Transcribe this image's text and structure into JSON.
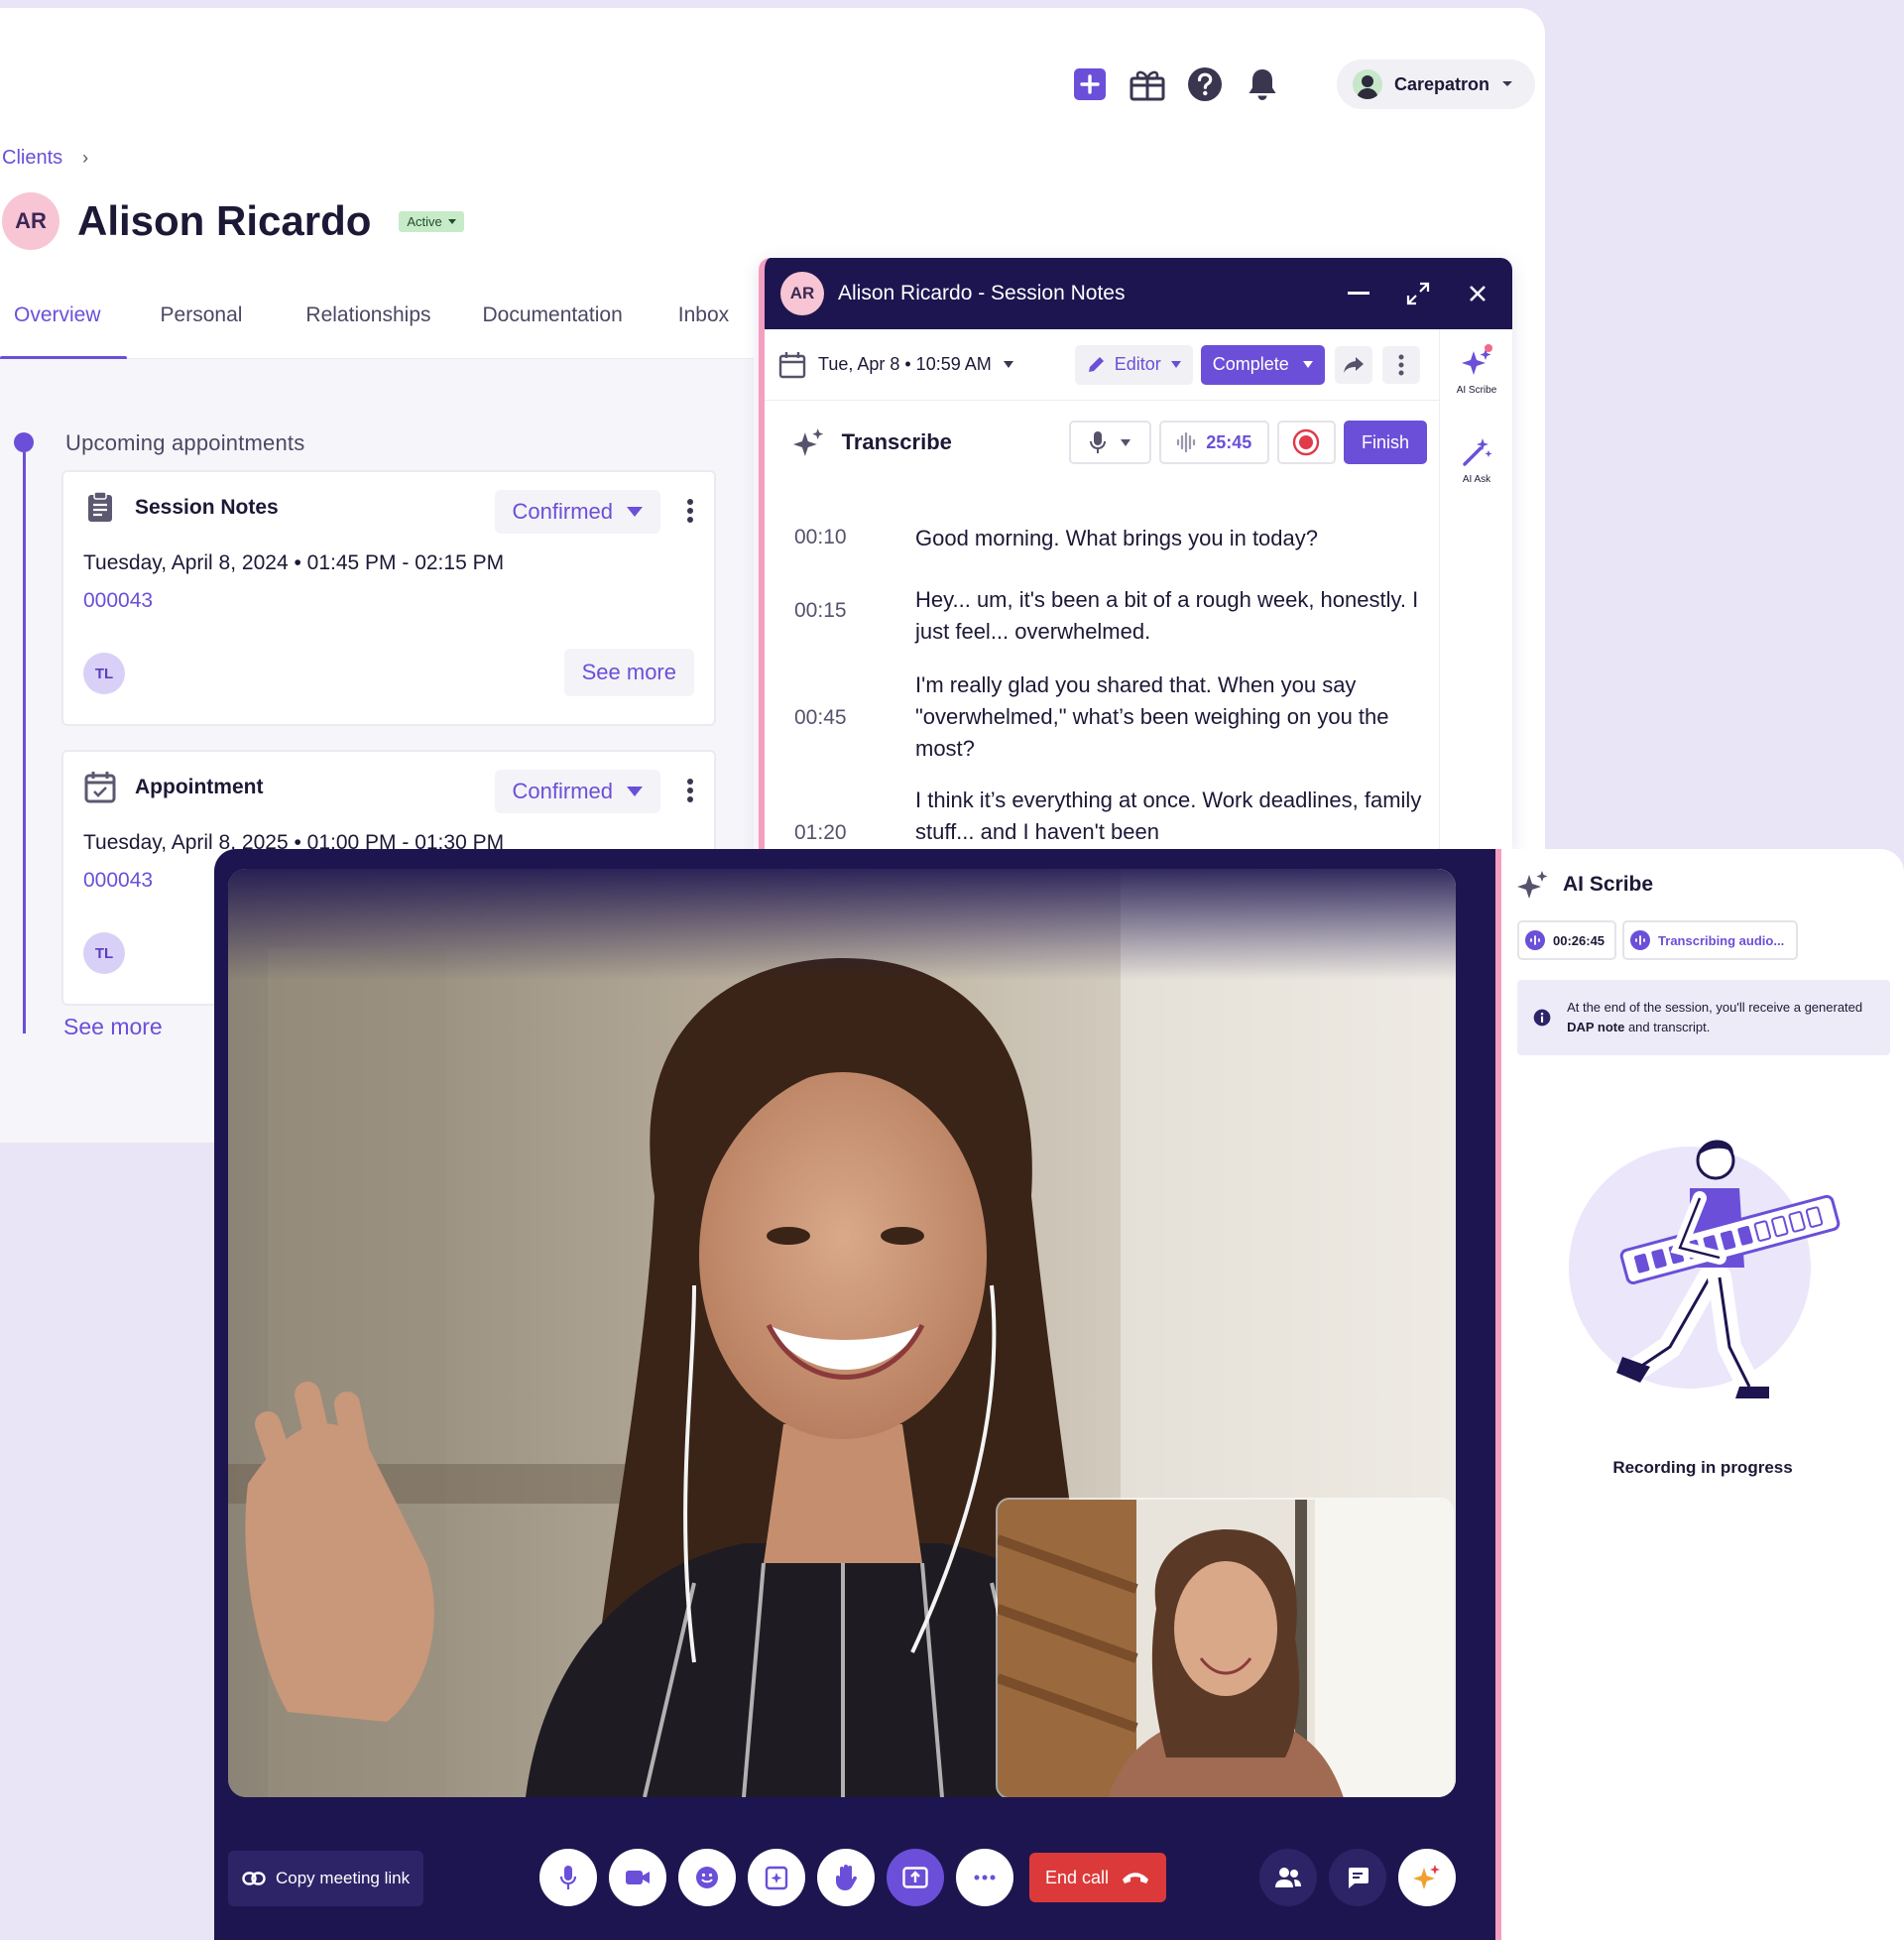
{
  "topbar": {
    "icons": [
      "add-icon",
      "gift-icon",
      "help-icon",
      "bell-icon"
    ],
    "user_name": "Carepatron"
  },
  "breadcrumb": {
    "root": "Clients"
  },
  "client": {
    "initials": "AR",
    "name": "Alison Ricardo",
    "status": "Active"
  },
  "tabs": [
    {
      "label": "Overview",
      "active": true
    },
    {
      "label": "Personal"
    },
    {
      "label": "Relationships"
    },
    {
      "label": "Documentation"
    },
    {
      "label": "Inbox"
    }
  ],
  "upcoming": {
    "label": "Upcoming appointments",
    "cards": [
      {
        "title": "Session Notes",
        "status": "Confirmed",
        "date": "Tuesday, April 8, 2024 • 01:45 PM - 02:15 PM",
        "id": "000043",
        "assignee": "TL",
        "see_more": "See more"
      },
      {
        "title": "Appointment",
        "status": "Confirmed",
        "date": "Tuesday, April 8, 2025 • 01:00 PM - 01:30 PM",
        "id": "000043",
        "assignee": "TL"
      }
    ],
    "see_more": "See more"
  },
  "notes_panel": {
    "avatar": "AR",
    "title": "Alison Ricardo - Session Notes",
    "date": "Tue, Apr 8 • 10:59 AM",
    "editor_label": "Editor",
    "complete_label": "Complete",
    "rail": [
      {
        "label": "AI Scribe"
      },
      {
        "label": "AI Ask"
      }
    ],
    "transcribe": {
      "title": "Transcribe",
      "timer": "25:45",
      "finish_label": "Finish"
    },
    "transcript": [
      {
        "time": "00:10",
        "text": "Good morning. What brings you in today?"
      },
      {
        "time": "00:15",
        "text": "Hey... um, it's been a bit of a rough week, honestly. I just feel... overwhelmed."
      },
      {
        "time": "00:45",
        "text": "I'm really glad you shared that. When you say \"overwhelmed,\" what’s been weighing on you the most?"
      },
      {
        "time": "01:20",
        "text": "I think it’s everything at once. Work deadlines, family stuff... and I haven't been"
      }
    ]
  },
  "call": {
    "copy_link": "Copy meeting link",
    "end_call": "End call"
  },
  "scribe": {
    "title": "AI Scribe",
    "timer": "00:26:45",
    "status": "Transcribing audio...",
    "info_prefix": "At the end of the session, you'll receive a generated ",
    "info_bold": "DAP note",
    "info_suffix": " and transcript.",
    "recording": "Recording in progress"
  }
}
